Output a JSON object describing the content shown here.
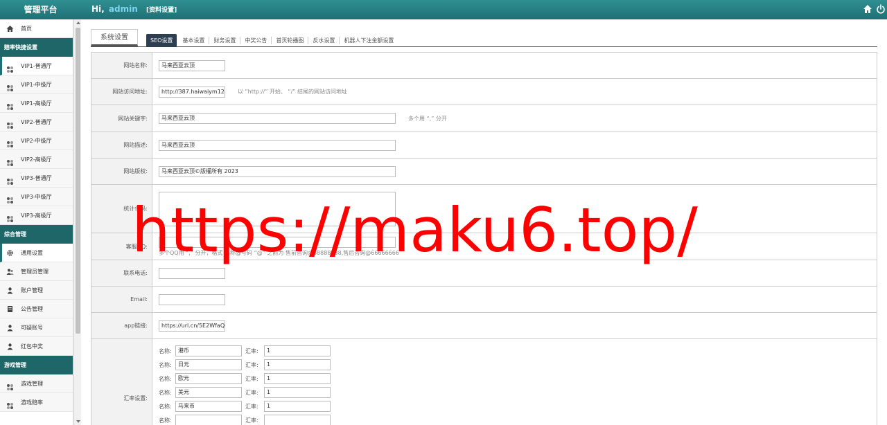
{
  "header": {
    "brand": "管理平台",
    "greeting_prefix": "Hi,",
    "username": "admin",
    "profile_link": "[资料设置]",
    "icons": [
      "home-icon",
      "power-icon"
    ]
  },
  "sidebar": {
    "home": "首页",
    "sections": [
      {
        "title": "赔率快捷设置",
        "items": [
          "VIP1-普通厅",
          "VIP1-中级厅",
          "VIP1-高级厅",
          "VIP2-普通厅",
          "VIP2-中级厅",
          "VIP2-高级厅",
          "VIP3-普通厅",
          "VIP3-中级厅",
          "VIP3-高级厅"
        ]
      },
      {
        "title": "综合管理",
        "items": [
          "通用设置",
          "管理员管理",
          "账户管理",
          "公告管理",
          "可疑账号",
          "红包中奖"
        ]
      },
      {
        "title": "游戏管理",
        "items": [
          "游戏管理",
          "游戏赔率"
        ]
      }
    ]
  },
  "main": {
    "section_title": "系统设置",
    "tabs": [
      "SEO设置",
      "基本设置",
      "财务设置",
      "中奖公告",
      "首页轮播图",
      "反水设置",
      "机器人下注金额设置"
    ],
    "active_tab": "SEO设置",
    "fields": {
      "site_name": {
        "label": "网站名称:",
        "value": "马来西亚云顶"
      },
      "site_url": {
        "label": "网站访问地址:",
        "value": "http://387.haiwaiym12.",
        "hint": "以 “http://” 开始、 “/” 结尾的网站访问地址"
      },
      "keywords": {
        "label": "网站关键字:",
        "value": "马来西亚云顶",
        "hint": "多个用 “,” 分开"
      },
      "description": {
        "label": "网站描述:",
        "value": "马来西亚云顶"
      },
      "copyright": {
        "label": "网站版权:",
        "value": "马来西亚云顶©版權所有 2023"
      },
      "stats_code": {
        "label": "统计代码:",
        "value": ""
      },
      "customer_service": {
        "label": "客服QQ:",
        "value": "",
        "hint": "多个QQ用 “,” 分开，格式 名称@号码 “@” 之前为 售前咨询@88888888,售后咨询@66666666"
      },
      "phone": {
        "label": "联系电话:",
        "value": ""
      },
      "email": {
        "label": "Email:",
        "value": ""
      },
      "app_link": {
        "label": "app链接:",
        "value": "https://url.cn/5E2WfaQ"
      }
    },
    "exchange": {
      "label": "汇率设置:",
      "name_label": "名称:",
      "rate_label": "汇率:",
      "rows": [
        {
          "name": "港币",
          "rate": "1"
        },
        {
          "name": "日元",
          "rate": "1"
        },
        {
          "name": "欧元",
          "rate": "1"
        },
        {
          "name": "美元",
          "rate": "1"
        },
        {
          "name": "马来币",
          "rate": "1"
        },
        {
          "name": "",
          "rate": ""
        }
      ]
    }
  },
  "watermark": "https://maku6.top/",
  "colors": {
    "topbar": "#1f7074",
    "sidebar_head": "#1f6669",
    "active_tab": "#2c3e50",
    "watermark": "#ff0000",
    "username": "#7fd3f0"
  }
}
